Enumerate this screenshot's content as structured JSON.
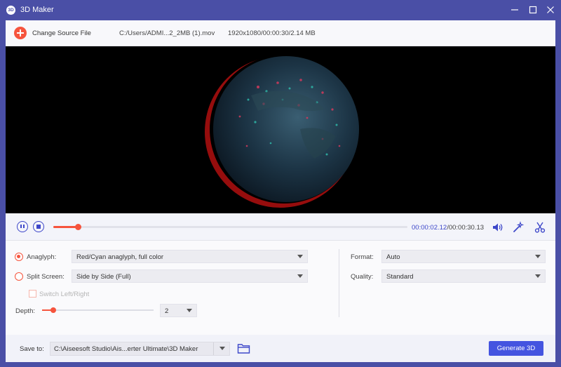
{
  "window": {
    "title": "3D Maker",
    "app_icon_text": "3D",
    "controls": [
      "minimize-icon",
      "maximize-icon",
      "close-icon"
    ]
  },
  "source": {
    "change_label": "Change Source File",
    "file_path": "C:/Users/ADMI...2_2MB (1).mov",
    "file_info": "1920x1080/00:00:30/2.14 MB"
  },
  "playback": {
    "current_time": "00:00:02.12",
    "total_time": "00:00:30.13",
    "separator": "/",
    "progress": 0.07,
    "icons": [
      "pause-icon",
      "stop-icon",
      "volume-icon",
      "magic-wand-icon",
      "scissors-icon"
    ]
  },
  "settings": {
    "anaglyph": {
      "label": "Anaglyph:",
      "value": "Red/Cyan anaglyph, full color",
      "selected": true
    },
    "split_screen": {
      "label": "Split Screen:",
      "value": "Side by Side (Full)",
      "selected": false
    },
    "switch_lr": {
      "label": "Switch Left/Right",
      "checked": false,
      "disabled": true
    },
    "depth": {
      "label": "Depth:",
      "value": "2",
      "slider": 0.1
    },
    "format": {
      "label": "Format:",
      "value": "Auto"
    },
    "quality": {
      "label": "Quality:",
      "value": "Standard"
    }
  },
  "footer": {
    "save_label": "Save to:",
    "save_path": "C:\\Aiseesoft Studio\\Ais...erter Ultimate\\3D Maker",
    "generate_label": "Generate 3D",
    "folder_icon": "folder-icon"
  },
  "colors": {
    "titlebar": "#4a4fa6",
    "accent": "#f6543d",
    "primary": "#4454e0",
    "time_highlight": "#3d47c9"
  }
}
